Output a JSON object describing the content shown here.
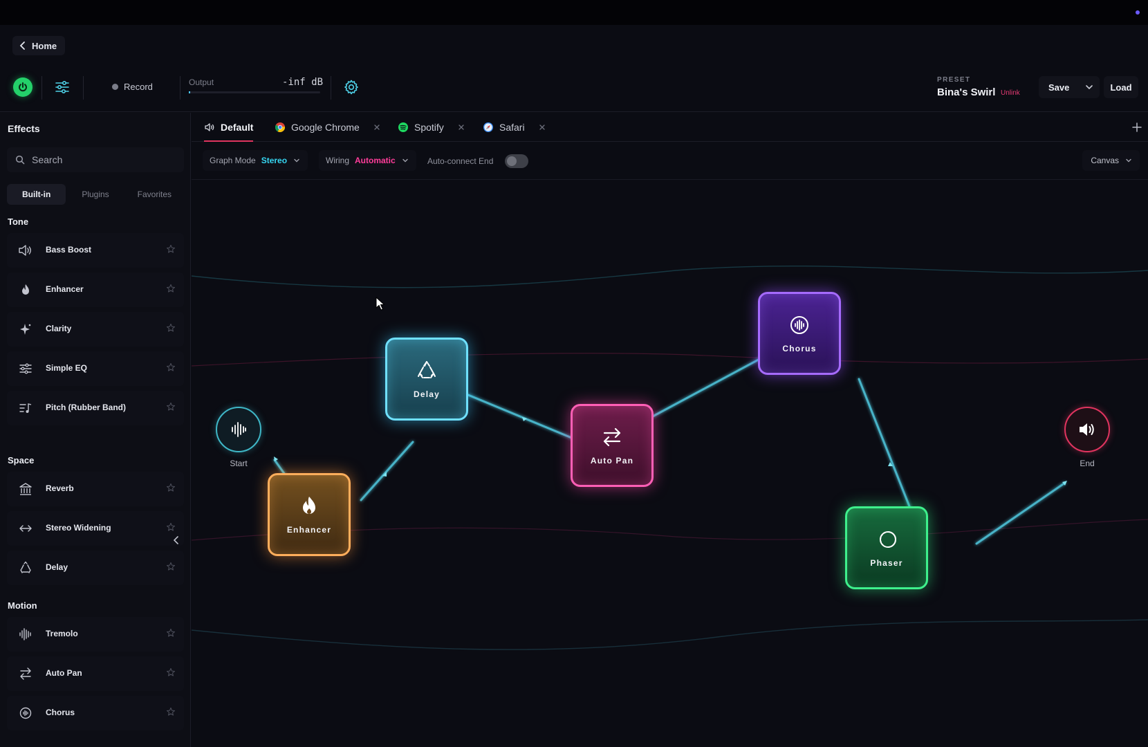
{
  "header": {
    "home_label": "Home",
    "record_label": "Record",
    "output_label": "Output",
    "output_level": "-inf dB",
    "preset_label": "PRESET",
    "preset_name": "Bina's Swirl",
    "unlink_label": "Unlink",
    "save_label": "Save",
    "load_label": "Load"
  },
  "sidebar": {
    "title": "Effects",
    "search_placeholder": "Search",
    "segments": [
      "Built-in",
      "Plugins",
      "Favorites"
    ],
    "active_segment": "Built-in",
    "categories": [
      {
        "name": "Tone",
        "items": [
          {
            "label": "Bass Boost",
            "icon": "speaker-icon"
          },
          {
            "label": "Enhancer",
            "icon": "flame-icon"
          },
          {
            "label": "Clarity",
            "icon": "sparkle-icon"
          },
          {
            "label": "Simple EQ",
            "icon": "sliders-icon"
          },
          {
            "label": "Pitch (Rubber Band)",
            "icon": "pitch-icon"
          }
        ]
      },
      {
        "name": "Space",
        "items": [
          {
            "label": "Reverb",
            "icon": "hall-icon"
          },
          {
            "label": "Stereo Widening",
            "icon": "arrows-horizontal-icon"
          },
          {
            "label": "Delay",
            "icon": "recycle-icon"
          }
        ]
      },
      {
        "name": "Motion",
        "items": [
          {
            "label": "Tremolo",
            "icon": "waveform-icon"
          },
          {
            "label": "Auto Pan",
            "icon": "swap-arrows-icon"
          },
          {
            "label": "Chorus",
            "icon": "circle-wave-icon"
          }
        ]
      }
    ]
  },
  "tabs": [
    {
      "label": "Default",
      "icon": "speaker-icon",
      "active": true
    },
    {
      "label": "Google Chrome",
      "icon": "chrome-icon",
      "closable": true
    },
    {
      "label": "Spotify",
      "icon": "spotify-icon",
      "closable": true
    },
    {
      "label": "Safari",
      "icon": "safari-icon",
      "closable": true
    }
  ],
  "controls": {
    "graph_mode_label": "Graph Mode",
    "graph_mode_value": "Stereo",
    "wiring_label": "Wiring",
    "wiring_value": "Automatic",
    "auto_connect_label": "Auto-connect End",
    "auto_connect_on": false,
    "canvas_label": "Canvas"
  },
  "graph": {
    "start_label": "Start",
    "end_label": "End",
    "nodes": [
      {
        "label": "Delay",
        "icon": "recycle-icon"
      },
      {
        "label": "Enhancer",
        "icon": "flame-icon"
      },
      {
        "label": "Auto Pan",
        "icon": "swap-arrows-icon"
      },
      {
        "label": "Chorus",
        "icon": "circle-wave-icon"
      },
      {
        "label": "Phaser",
        "icon": "phaser-icon"
      }
    ]
  },
  "colors": {
    "accent_red": "#e0345f",
    "power_green": "#24d16a",
    "stereo_cyan": "#36d6f2",
    "automatic_pink": "#ff3d9a",
    "delay": "#6fe0ff",
    "enhancer": "#ffae5c",
    "autopan": "#ff5fb6",
    "chorus": "#a66bff",
    "phaser": "#3ef08c"
  }
}
